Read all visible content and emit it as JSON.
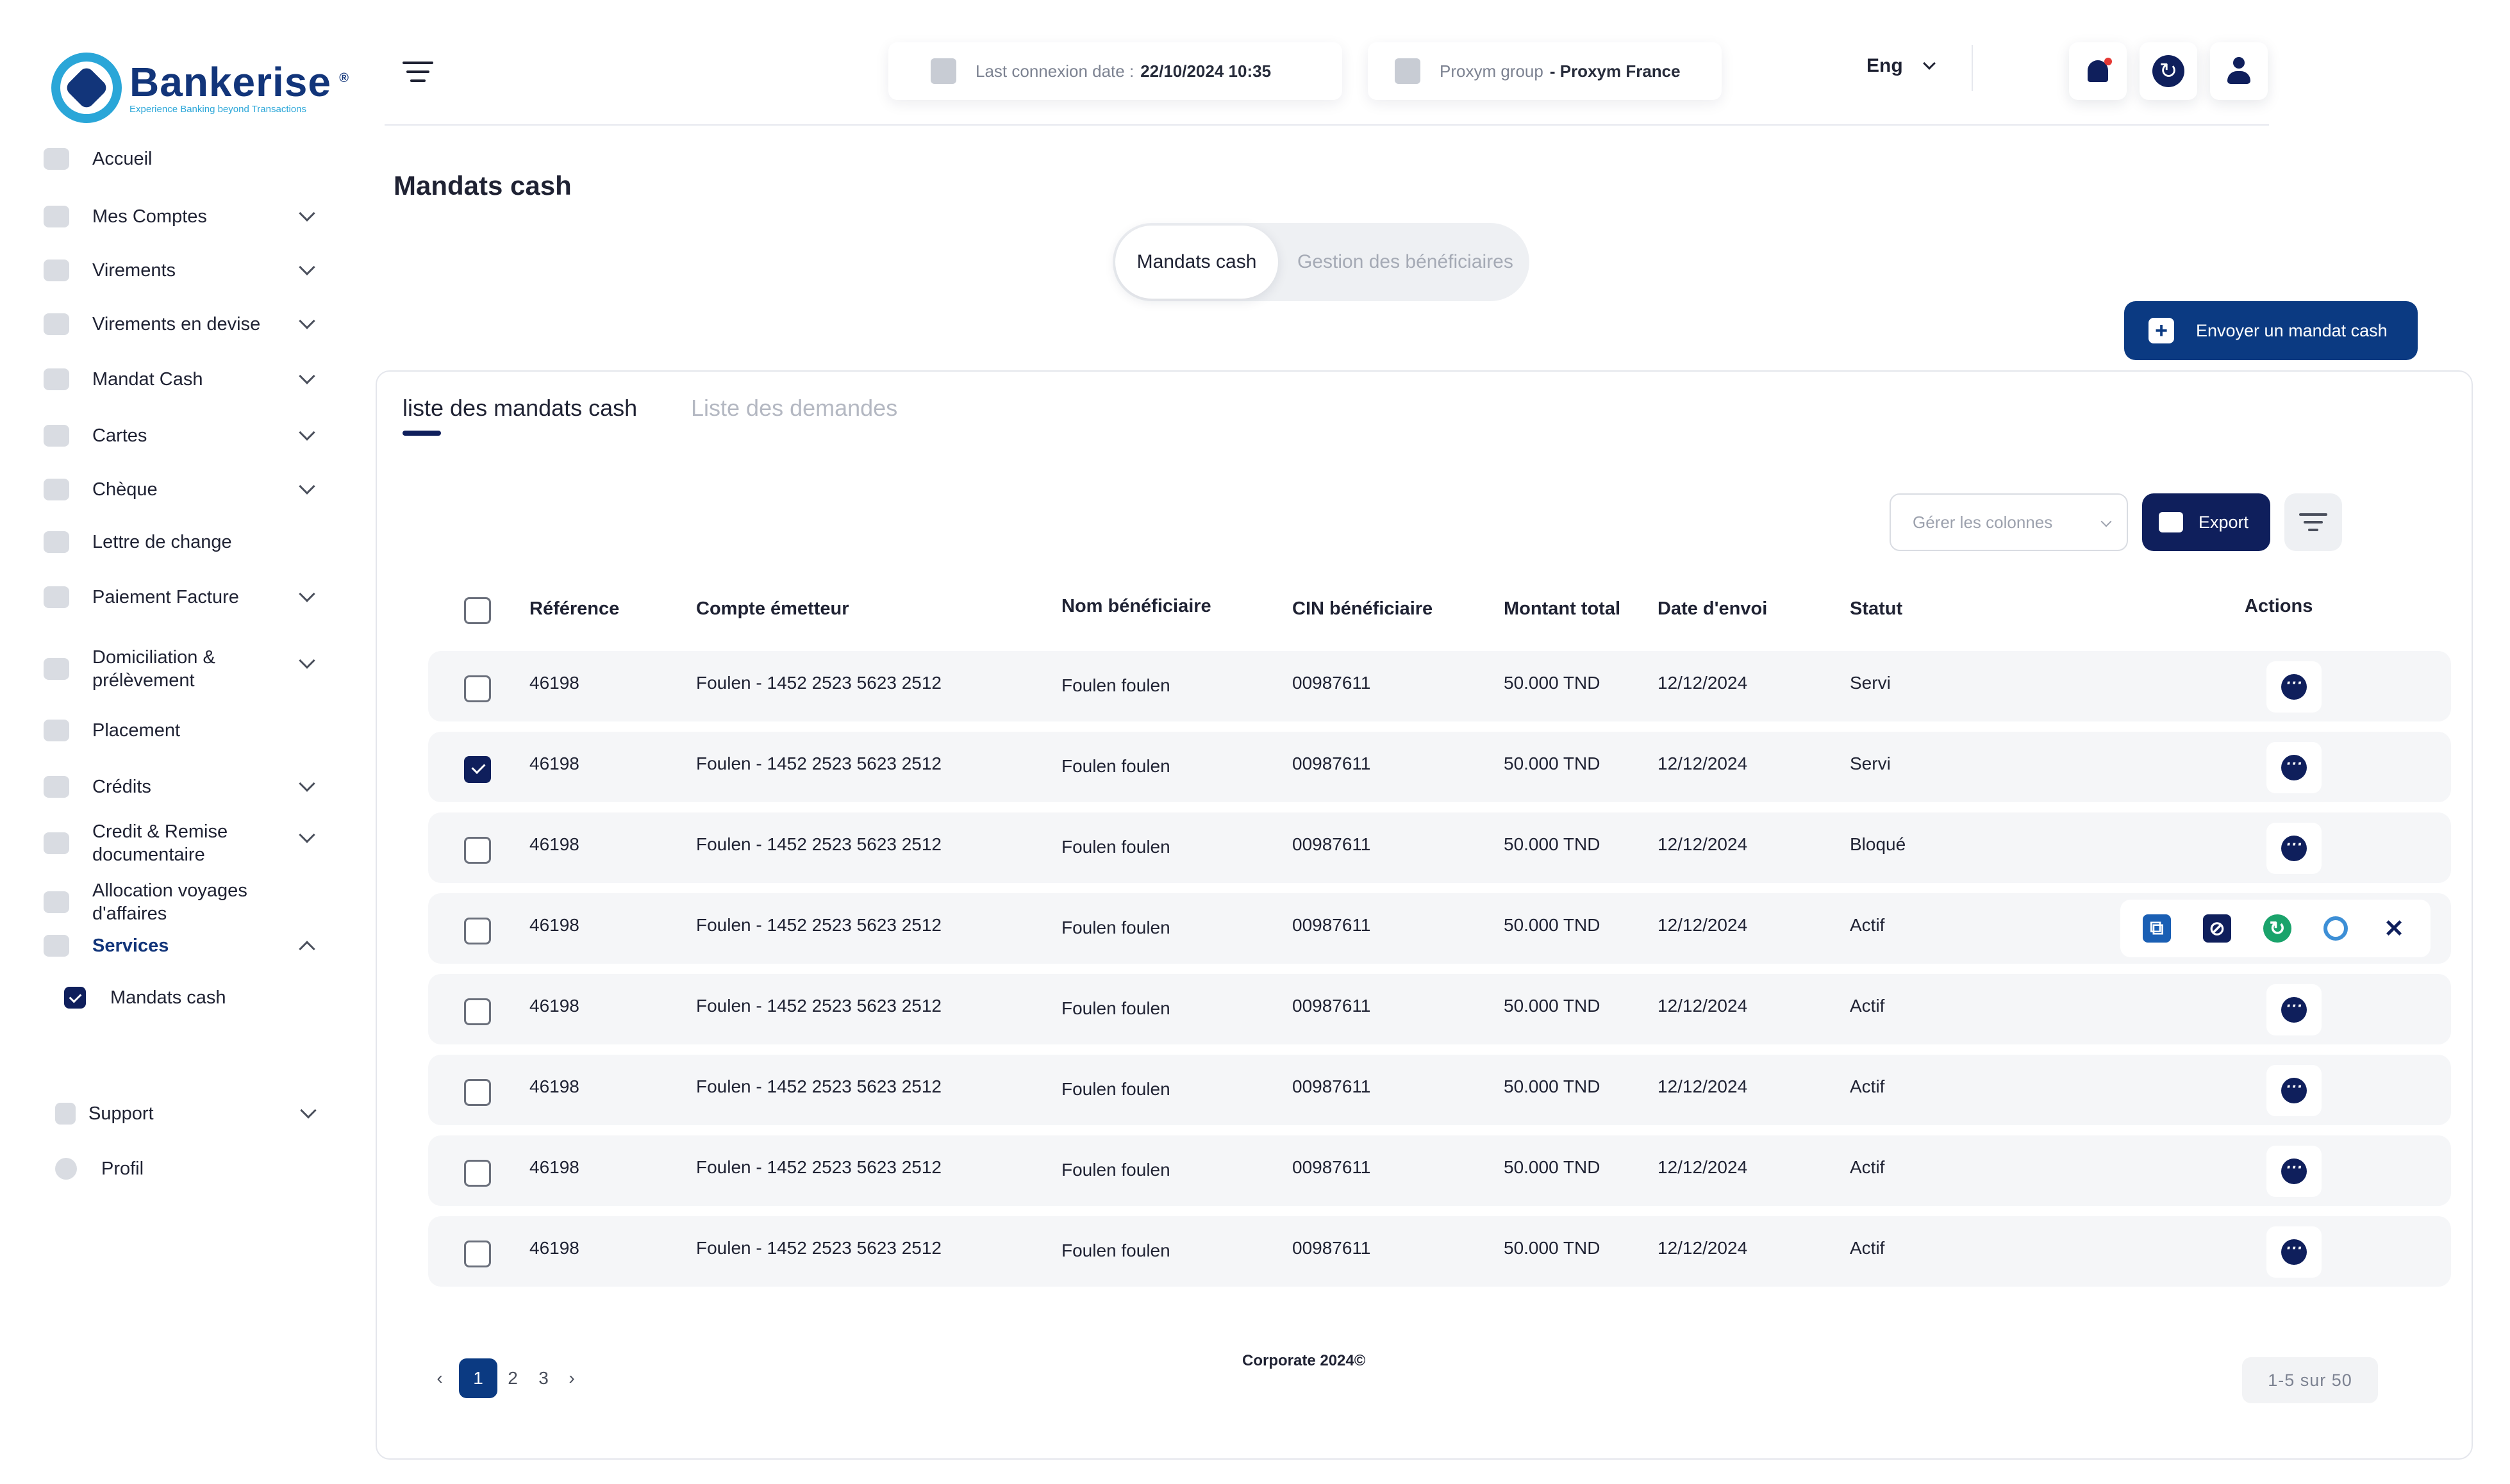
{
  "brand": {
    "name": "Bankerise",
    "reg": "®",
    "tagline": "Experience Banking beyond Transactions"
  },
  "sidebar": {
    "items": [
      {
        "label": "Accueil",
        "icon": "home-icon"
      },
      {
        "label": "Mes Comptes",
        "icon": "folder-icon"
      },
      {
        "label": "Virements",
        "icon": "transfer-icon"
      },
      {
        "label": "Virements en devise",
        "icon": "currency-icon"
      },
      {
        "label": "Mandat Cash",
        "icon": "cash-icon"
      },
      {
        "label": "Cartes",
        "icon": "card-icon"
      },
      {
        "label": "Chèque",
        "icon": "cheque-icon"
      },
      {
        "label": "Lettre de change",
        "icon": "letter-icon"
      },
      {
        "label": "Paiement Facture",
        "icon": "invoice-icon"
      },
      {
        "label": "Domiciliation & prélèvement",
        "icon": "domiciliation-icon"
      },
      {
        "label": "Placement",
        "icon": "chart-icon"
      },
      {
        "label": "Crédits",
        "icon": "credit-icon"
      },
      {
        "label": "Credit & Remise documentaire",
        "icon": "document-icon"
      },
      {
        "label": "Allocation  voyages d'affaires",
        "icon": "travel-icon"
      },
      {
        "label": "Services",
        "icon": "services-icon"
      }
    ],
    "sub_item": "Mandats cash",
    "support": "Support",
    "profile": "Profil"
  },
  "header": {
    "last_connexion_label": "Last connexion date :",
    "last_connexion_value": "22/10/2024 10:35",
    "group_label": "Proxym group",
    "group_value": "- Proxym France",
    "language": "Eng"
  },
  "page": {
    "title": "Mandats cash",
    "segment_active": "Mandats cash",
    "segment_inactive": "Gestion des bénéficiaires",
    "send_button": "Envoyer un mandat cash",
    "tab_active": "liste des mandats cash",
    "tab_inactive": "Liste des demandes",
    "columns_placeholder": "Gérer les colonnes",
    "export_label": "Export"
  },
  "table": {
    "headers": {
      "reference": "Référence",
      "compte": "Compte émetteur",
      "nom": "Nom bénéficiaire",
      "cin": "CIN  bénéficiaire",
      "montant": "Montant total",
      "date": "Date d'envoi",
      "statut": "Statut",
      "actions": "Actions"
    },
    "rows": [
      {
        "ref": "46198",
        "compte": "Foulen - 1452 2523 5623 2512",
        "nom": "Foulen foulen",
        "cin": "00987611",
        "montant": "50.000 TND",
        "date": "12/12/2024",
        "statut": "Servi"
      },
      {
        "ref": "46198",
        "compte": "Foulen - 1452 2523 5623 2512",
        "nom": "Foulen foulen",
        "cin": "00987611",
        "montant": "50.000 TND",
        "date": "12/12/2024",
        "statut": "Servi"
      },
      {
        "ref": "46198",
        "compte": "Foulen - 1452 2523 5623 2512",
        "nom": "Foulen foulen",
        "cin": "00987611",
        "montant": "50.000 TND",
        "date": "12/12/2024",
        "statut": "Bloqué"
      },
      {
        "ref": "46198",
        "compte": "Foulen - 1452 2523 5623 2512",
        "nom": "Foulen foulen",
        "cin": "00987611",
        "montant": "50.000 TND",
        "date": "12/12/2024",
        "statut": "Actif"
      },
      {
        "ref": "46198",
        "compte": "Foulen - 1452 2523 5623 2512",
        "nom": "Foulen foulen",
        "cin": "00987611",
        "montant": "50.000 TND",
        "date": "12/12/2024",
        "statut": "Actif"
      },
      {
        "ref": "46198",
        "compte": "Foulen - 1452 2523 5623 2512",
        "nom": "Foulen foulen",
        "cin": "00987611",
        "montant": "50.000 TND",
        "date": "12/12/2024",
        "statut": "Actif"
      },
      {
        "ref": "46198",
        "compte": "Foulen - 1452 2523 5623 2512",
        "nom": "Foulen foulen",
        "cin": "00987611",
        "montant": "50.000 TND",
        "date": "12/12/2024",
        "statut": "Actif"
      },
      {
        "ref": "46198",
        "compte": "Foulen - 1452 2523 5623 2512",
        "nom": "Foulen foulen",
        "cin": "00987611",
        "montant": "50.000 TND",
        "date": "12/12/2024",
        "statut": "Actif"
      }
    ],
    "action_glyphs": {
      "renew": "↻",
      "close": "✕"
    }
  },
  "pagination": {
    "pages": [
      "1",
      "2",
      "3"
    ],
    "prev": "‹",
    "next": "›",
    "count": "1-5 sur 50"
  },
  "footer": {
    "text": "Corporate 2024©"
  },
  "colors": {
    "primary": "#0f1f5c",
    "accent": "#0b3a82",
    "brand_blue": "#2aa6d8",
    "renew": "#1aa36b"
  }
}
